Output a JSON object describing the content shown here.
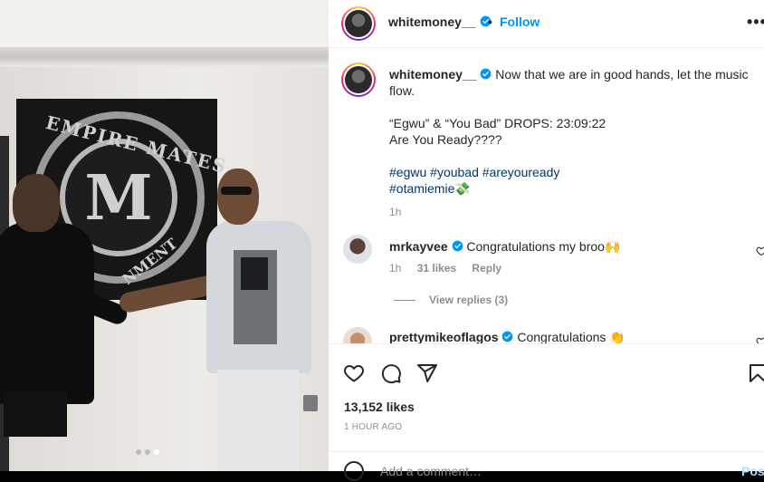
{
  "post": {
    "username": "whitemoney__",
    "separator": "•",
    "follow_label": "Follow",
    "more_label": "•••",
    "carousel": {
      "count": 3,
      "active_index": 2
    }
  },
  "caption": {
    "username": "whitemoney__",
    "line1": "Now that we are in good hands, let the music flow.",
    "line2": "“Egwu” & “You Bad” DROPS: 23:09:22",
    "line3": "Are You Ready????",
    "hashtags_row1": [
      "#egwu",
      "#youbad",
      "#areyouready"
    ],
    "hashtags_row2": "#otamiemie",
    "emoji": "💸",
    "time": "1h"
  },
  "comments": [
    {
      "username": "mrkayvee",
      "text": "Congratulations my broo",
      "emoji": "🙌",
      "time": "1h",
      "likes": "31 likes",
      "reply_label": "Reply",
      "view_replies": "View replies (3)"
    },
    {
      "username": "prettymikeoflagos",
      "text": "Congratulations",
      "emoji": "👏"
    }
  ],
  "footer": {
    "likes": "13,152 likes",
    "posted": "1 HOUR AGO",
    "add_comment_placeholder": "Add a comment…",
    "post_label": "Post"
  },
  "image_text": {
    "sign_top": "EMPIRE MATES",
    "sign_letter": "M",
    "sign_bottom": "NMENT"
  },
  "colors": {
    "link_blue": "#0095f6",
    "hashtag": "#00376b",
    "muted": "#8e8e8e",
    "verified": "#0095f6"
  },
  "icons": [
    "verified-badge-icon",
    "heart-icon",
    "comment-icon",
    "share-icon",
    "bookmark-icon",
    "emoji-smile-icon",
    "more-options-icon"
  ]
}
